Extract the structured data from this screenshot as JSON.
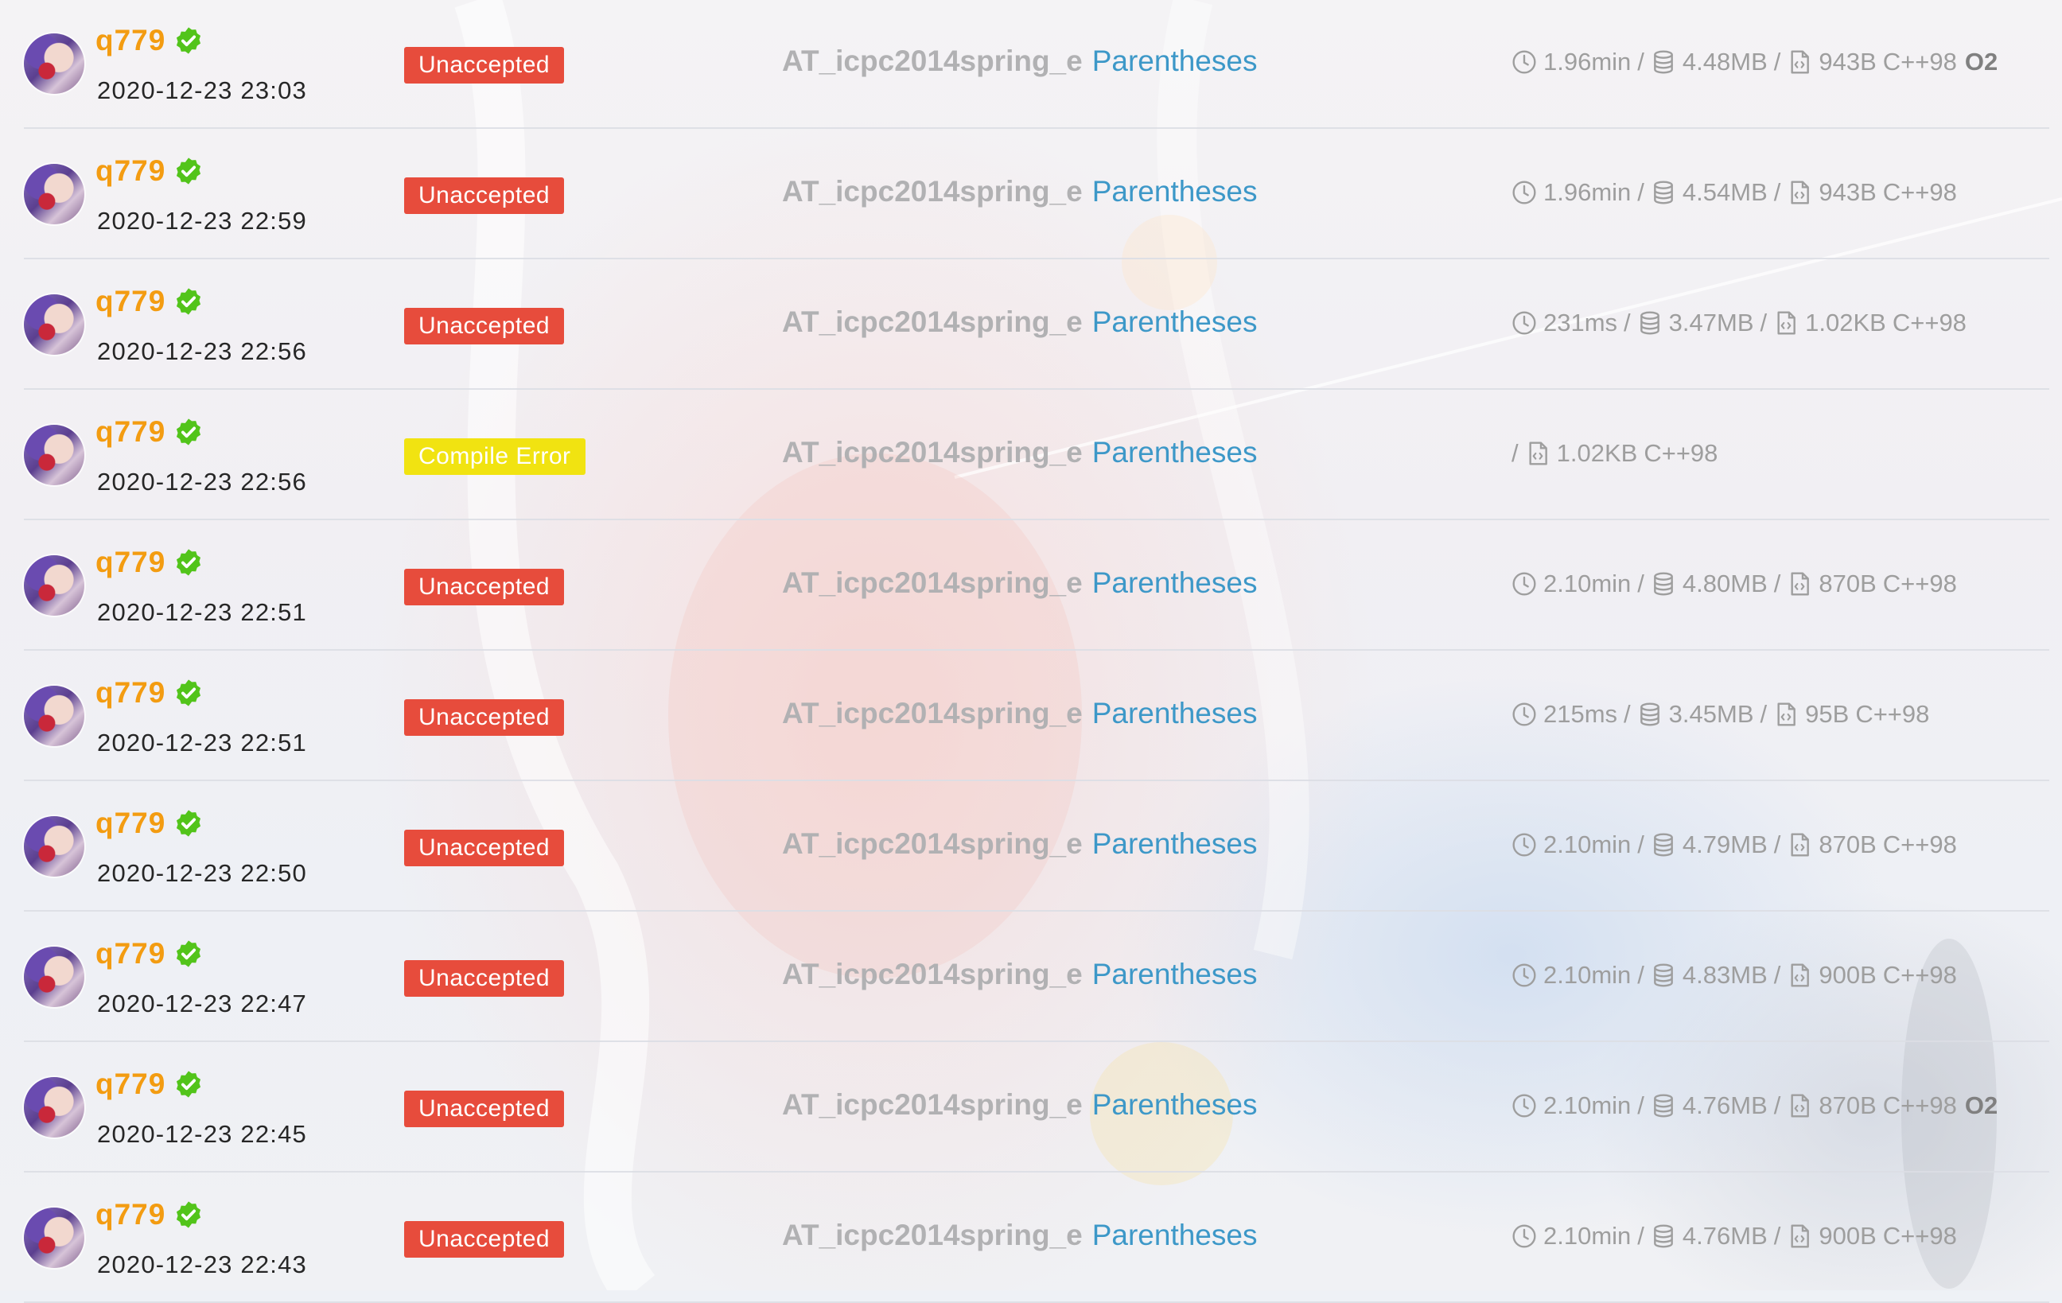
{
  "records": [
    {
      "user": "q779",
      "time": "2020-12-23 23:03",
      "status": "Unaccepted",
      "status_type": "ua",
      "problem_id": "AT_icpc2014spring_e",
      "problem_name": "Parentheses",
      "duration": "1.96min",
      "memory": "4.48MB",
      "code_size": "943B",
      "language": "C++98",
      "o2": "O2"
    },
    {
      "user": "q779",
      "time": "2020-12-23 22:59",
      "status": "Unaccepted",
      "status_type": "ua",
      "problem_id": "AT_icpc2014spring_e",
      "problem_name": "Parentheses",
      "duration": "1.96min",
      "memory": "4.54MB",
      "code_size": "943B",
      "language": "C++98",
      "o2": ""
    },
    {
      "user": "q779",
      "time": "2020-12-23 22:56",
      "status": "Unaccepted",
      "status_type": "ua",
      "problem_id": "AT_icpc2014spring_e",
      "problem_name": "Parentheses",
      "duration": "231ms",
      "memory": "3.47MB",
      "code_size": "1.02KB",
      "language": "C++98",
      "o2": ""
    },
    {
      "user": "q779",
      "time": "2020-12-23 22:56",
      "status": "Compile Error",
      "status_type": "ce",
      "problem_id": "AT_icpc2014spring_e",
      "problem_name": "Parentheses",
      "duration": "",
      "memory": "",
      "code_size": "1.02KB",
      "language": "C++98",
      "o2": ""
    },
    {
      "user": "q779",
      "time": "2020-12-23 22:51",
      "status": "Unaccepted",
      "status_type": "ua",
      "problem_id": "AT_icpc2014spring_e",
      "problem_name": "Parentheses",
      "duration": "2.10min",
      "memory": "4.80MB",
      "code_size": "870B",
      "language": "C++98",
      "o2": ""
    },
    {
      "user": "q779",
      "time": "2020-12-23 22:51",
      "status": "Unaccepted",
      "status_type": "ua",
      "problem_id": "AT_icpc2014spring_e",
      "problem_name": "Parentheses",
      "duration": "215ms",
      "memory": "3.45MB",
      "code_size": "95B",
      "language": "C++98",
      "o2": ""
    },
    {
      "user": "q779",
      "time": "2020-12-23 22:50",
      "status": "Unaccepted",
      "status_type": "ua",
      "problem_id": "AT_icpc2014spring_e",
      "problem_name": "Parentheses",
      "duration": "2.10min",
      "memory": "4.79MB",
      "code_size": "870B",
      "language": "C++98",
      "o2": ""
    },
    {
      "user": "q779",
      "time": "2020-12-23 22:47",
      "status": "Unaccepted",
      "status_type": "ua",
      "problem_id": "AT_icpc2014spring_e",
      "problem_name": "Parentheses",
      "duration": "2.10min",
      "memory": "4.83MB",
      "code_size": "900B",
      "language": "C++98",
      "o2": ""
    },
    {
      "user": "q779",
      "time": "2020-12-23 22:45",
      "status": "Unaccepted",
      "status_type": "ua",
      "problem_id": "AT_icpc2014spring_e",
      "problem_name": "Parentheses",
      "duration": "2.10min",
      "memory": "4.76MB",
      "code_size": "870B",
      "language": "C++98",
      "o2": "O2"
    },
    {
      "user": "q779",
      "time": "2020-12-23 22:43",
      "status": "Unaccepted",
      "status_type": "ua",
      "problem_id": "AT_icpc2014spring_e",
      "problem_name": "Parentheses",
      "duration": "2.10min",
      "memory": "4.76MB",
      "code_size": "900B",
      "language": "C++98",
      "o2": ""
    }
  ],
  "separator": "/",
  "icons": {
    "avatar": "avatar",
    "verified": "check-badge-icon",
    "time": "clock-icon",
    "memory": "database-icon",
    "code": "code-file-icon"
  },
  "colors": {
    "username": "#f39c11",
    "unaccepted": "#e74c3c",
    "compile_error": "#f1e311",
    "problem_id": "#b1b1b3",
    "problem_name": "#3d98c8",
    "meta_text": "#9e9e9e",
    "verified": "#52c41a"
  }
}
